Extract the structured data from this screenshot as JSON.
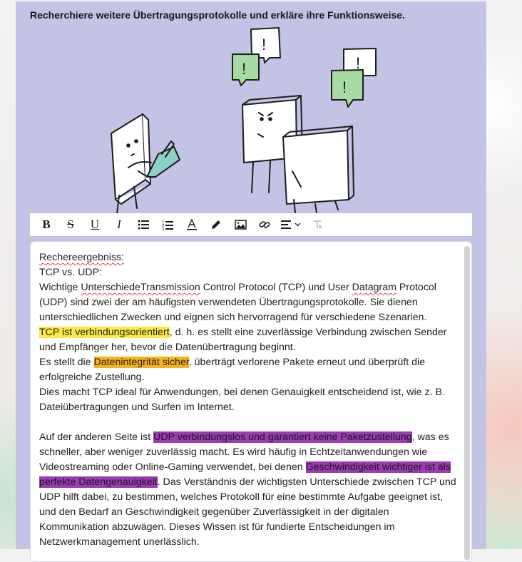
{
  "task": {
    "title": "Recherchiere weitere Übertragungsprotokolle und erkläre ihre Funktionsweise."
  },
  "illustration": {
    "icons": [
      "question-speech-bubble-icon",
      "exclamation-speech-bubble-icon"
    ]
  },
  "toolbar": {
    "buttons": [
      {
        "name": "bold",
        "glyph": "B"
      },
      {
        "name": "strikethrough",
        "glyph": "S"
      },
      {
        "name": "underline",
        "glyph": "U"
      },
      {
        "name": "italic",
        "glyph": "I"
      },
      {
        "name": "bullet-list",
        "glyph": "list-bullet-icon"
      },
      {
        "name": "numbered-list",
        "glyph": "list-ordered-icon"
      },
      {
        "name": "text-color",
        "glyph": "A"
      },
      {
        "name": "highlight",
        "glyph": "pen-icon"
      },
      {
        "name": "image",
        "glyph": "image-icon"
      },
      {
        "name": "link",
        "glyph": "link-icon"
      },
      {
        "name": "align",
        "glyph": "align-left-icon"
      },
      {
        "name": "clear-format",
        "glyph": "clear-format-icon"
      }
    ]
  },
  "editor": {
    "heading": "Rechereergebniss:",
    "subheading": "TCP vs. UDP:",
    "p1_a": "Wichtige ",
    "p1_sq1": "UnterschiedeTransmission",
    "p1_b": " Control Protocol (TCP) und User ",
    "p1_sq2": "Datagram",
    "p1_c": " Protocol (UDP) sind zwei der am häufigsten verwendeten Übertragungsprotokolle. Sie dienen unterschiedlichen Zwecken und eignen sich hervorragend für verschiedene Szenarien.",
    "p2_hl": "TCP ist verbindungsorientiert",
    "p2_rest": ", d. h. es stellt eine zuverlässige Verbindung zwischen Sender und Empfänger her, bevor die Datenübertragung beginnt.",
    "p3_a": "Es stellt die ",
    "p3_hl": "Datenintegrität sicher",
    "p3_rest": ", überträgt verlorene Pakete erneut und überprüft die erfolgreiche Zustellung.",
    "p4": "Dies macht TCP ideal für Anwendungen, bei denen Genauigkeit entscheidend ist, wie z. B. Dateiübertragungen und Surfen im Internet.",
    "p5_a": "Auf der anderen Seite ist ",
    "p5_hl1": "UDP verbindungslos und garantiert keine Paketzustellung",
    "p5_b": ", was es schneller, aber weniger zuverlässig macht. Es wird häufig in Echtzeitanwendungen wie Videostreaming oder Online-Gaming verwendet, bei denen ",
    "p5_hl2": "Geschwindigkeit wichtiger ist als perfekte Datengenauigkeit",
    "p5_c": ". Das Verständnis der wichtigsten Unterschiede zwischen TCP und UDP hilft dabei, zu bestimmen, welches Protokoll für eine bestimmte Aufgabe geeignet ist, und den Bedarf an Geschwindigkeit gegenüber Zuverlässigkeit in der digitalen Kommunikation abzuwägen. Dieses Wissen ist für fundierte Entscheidungen im Netzwerkmanagement unerlässlich."
  },
  "colors": {
    "card_bg": "#c3c4e5",
    "highlight_yellow": "#fbe946",
    "highlight_orange": "#f7b31b",
    "highlight_purple": "#9b3cb2",
    "bubble_green": "#a8dba3"
  }
}
